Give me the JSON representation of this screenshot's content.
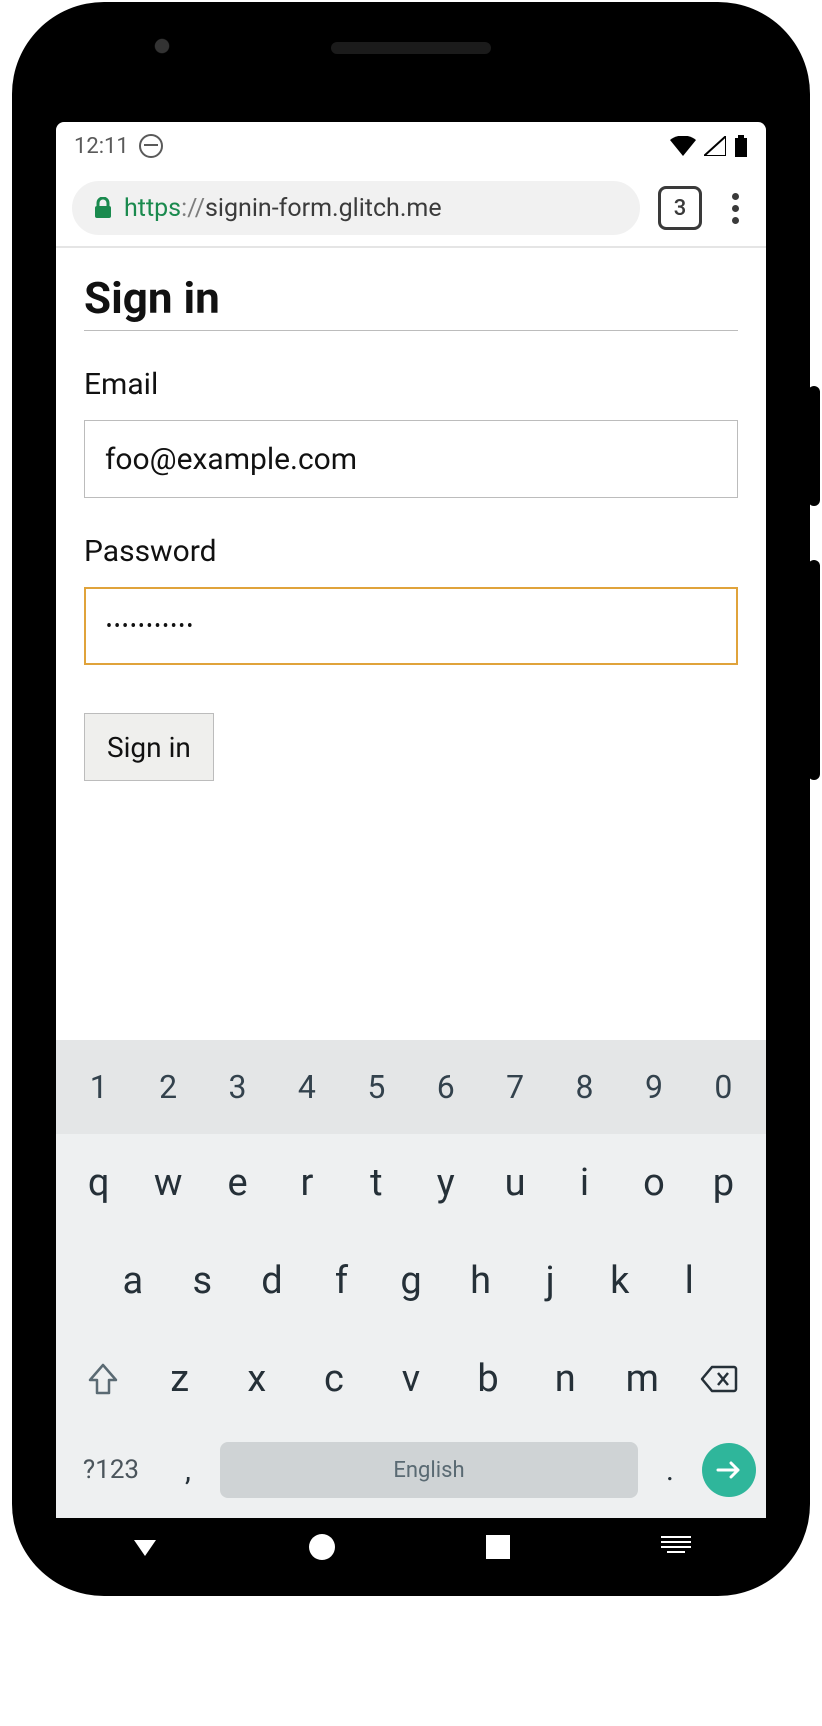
{
  "status": {
    "time": "12:11"
  },
  "browser": {
    "protocol": "https",
    "slashes": "://",
    "host_path": "signin-form.glitch.me",
    "tab_count": "3"
  },
  "page": {
    "title": "Sign in",
    "email": {
      "label": "Email",
      "value": "foo@example.com"
    },
    "password": {
      "label": "Password",
      "value": "•••••••••••"
    },
    "submit_label": "Sign in"
  },
  "keyboard": {
    "numbers": [
      "1",
      "2",
      "3",
      "4",
      "5",
      "6",
      "7",
      "8",
      "9",
      "0"
    ],
    "row1": [
      "q",
      "w",
      "e",
      "r",
      "t",
      "y",
      "u",
      "i",
      "o",
      "p"
    ],
    "row2": [
      "a",
      "s",
      "d",
      "f",
      "g",
      "h",
      "j",
      "k",
      "l"
    ],
    "row3": [
      "z",
      "x",
      "c",
      "v",
      "b",
      "n",
      "m"
    ],
    "symbols_label": "?123",
    "comma": ",",
    "dot": ".",
    "space_label": "English"
  }
}
